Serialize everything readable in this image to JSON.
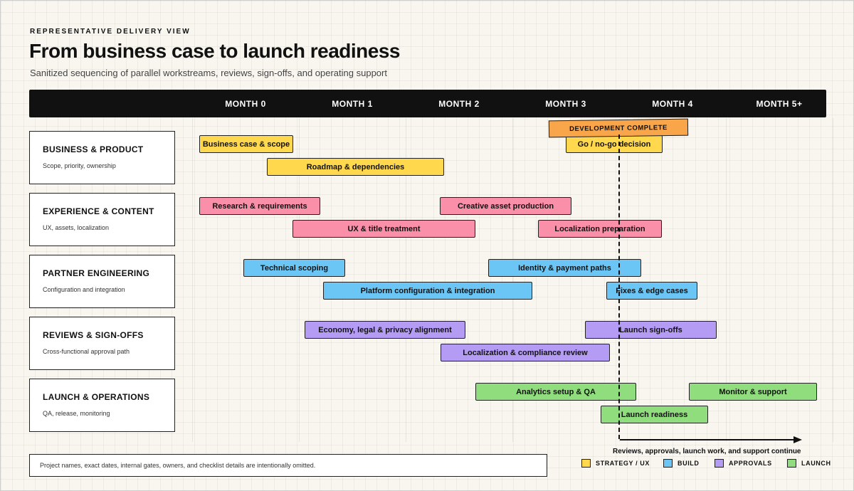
{
  "header": {
    "eyebrow": "REPRESENTATIVE DELIVERY VIEW",
    "title": "From business case to launch readiness",
    "subtitle": "Sanitized sequencing of parallel workstreams, reviews, sign-offs, and operating support"
  },
  "months": [
    "MONTH 0",
    "MONTH 1",
    "MONTH 2",
    "MONTH 3",
    "MONTH 4",
    "MONTH 5+"
  ],
  "lanes": [
    {
      "title": "BUSINESS & PRODUCT",
      "subtitle": "Scope, priority, ownership"
    },
    {
      "title": "EXPERIENCE & CONTENT",
      "subtitle": "UX, assets, localization"
    },
    {
      "title": "PARTNER ENGINEERING",
      "subtitle": "Configuration and integration"
    },
    {
      "title": "REVIEWS & SIGN-OFFS",
      "subtitle": "Cross-functional approval path"
    },
    {
      "title": "LAUNCH & OPERATIONS",
      "subtitle": "QA, release, monitoring"
    }
  ],
  "tasks": {
    "business_case": "Business case & scope",
    "roadmap": "Roadmap & dependencies",
    "go_no_go": "Go / no-go decision",
    "research": "Research & requirements",
    "ux_title": "UX & title treatment",
    "creative_assets": "Creative asset production",
    "localization_prep": "Localization preparation",
    "tech_scoping": "Technical scoping",
    "platform_config": "Platform configuration & integration",
    "identity_payment": "Identity & payment paths",
    "fixes": "Fixes & edge cases",
    "economy_legal": "Economy, legal & privacy alignment",
    "loc_compliance": "Localization & compliance review",
    "launch_signoffs": "Launch sign-offs",
    "analytics_qa": "Analytics setup & QA",
    "launch_readiness": "Launch readiness",
    "monitor_support": "Monitor & support"
  },
  "milestone": {
    "label": "DEVELOPMENT COMPLETE"
  },
  "continue_note": "Reviews, approvals, launch work, and support continue",
  "footnote": "Project names, exact dates, internal gates, owners, and checklist details are intentionally omitted.",
  "legend": [
    {
      "label": "STRATEGY / UX",
      "color": "#ffd84d"
    },
    {
      "label": "BUILD",
      "color": "#6cc6f5"
    },
    {
      "label": "APPROVALS",
      "color": "#b49cf5"
    },
    {
      "label": "LAUNCH",
      "color": "#8fdd7c"
    }
  ],
  "colors": {
    "strategy": "#ffd84d",
    "content": "#f98fa8",
    "build": "#6cc6f5",
    "approvals": "#b49cf5",
    "launch": "#8fdd7c",
    "milestone": "#f9a54a"
  }
}
